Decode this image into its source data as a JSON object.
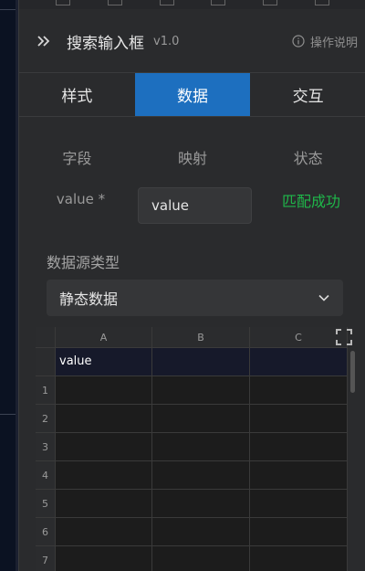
{
  "panel": {
    "title": "搜索输入框",
    "version": "v1.0",
    "help_label": "操作说明"
  },
  "tabs": [
    {
      "label": "样式",
      "active": false
    },
    {
      "label": "数据",
      "active": true
    },
    {
      "label": "交互",
      "active": false
    }
  ],
  "mapping": {
    "headers": [
      "字段",
      "映射",
      "状态"
    ],
    "rows": [
      {
        "field": "value *",
        "value": "value",
        "status": "匹配成功"
      }
    ]
  },
  "datasource": {
    "label": "数据源类型",
    "selected": "静态数据"
  },
  "sheet": {
    "columns": [
      "A",
      "B",
      "C"
    ],
    "header_cells": [
      "value",
      "",
      ""
    ],
    "row_numbers": [
      "1",
      "2",
      "3",
      "4",
      "5",
      "6",
      "7"
    ]
  },
  "colors": {
    "accent": "#1d6fbf",
    "success": "#1fb84a",
    "panel_bg": "#2a2b2d"
  },
  "icons": {
    "collapse": "double-chevron-right-icon",
    "help": "info-circle-icon",
    "select": "chevron-down-icon",
    "sheet": "fullscreen-icon"
  }
}
